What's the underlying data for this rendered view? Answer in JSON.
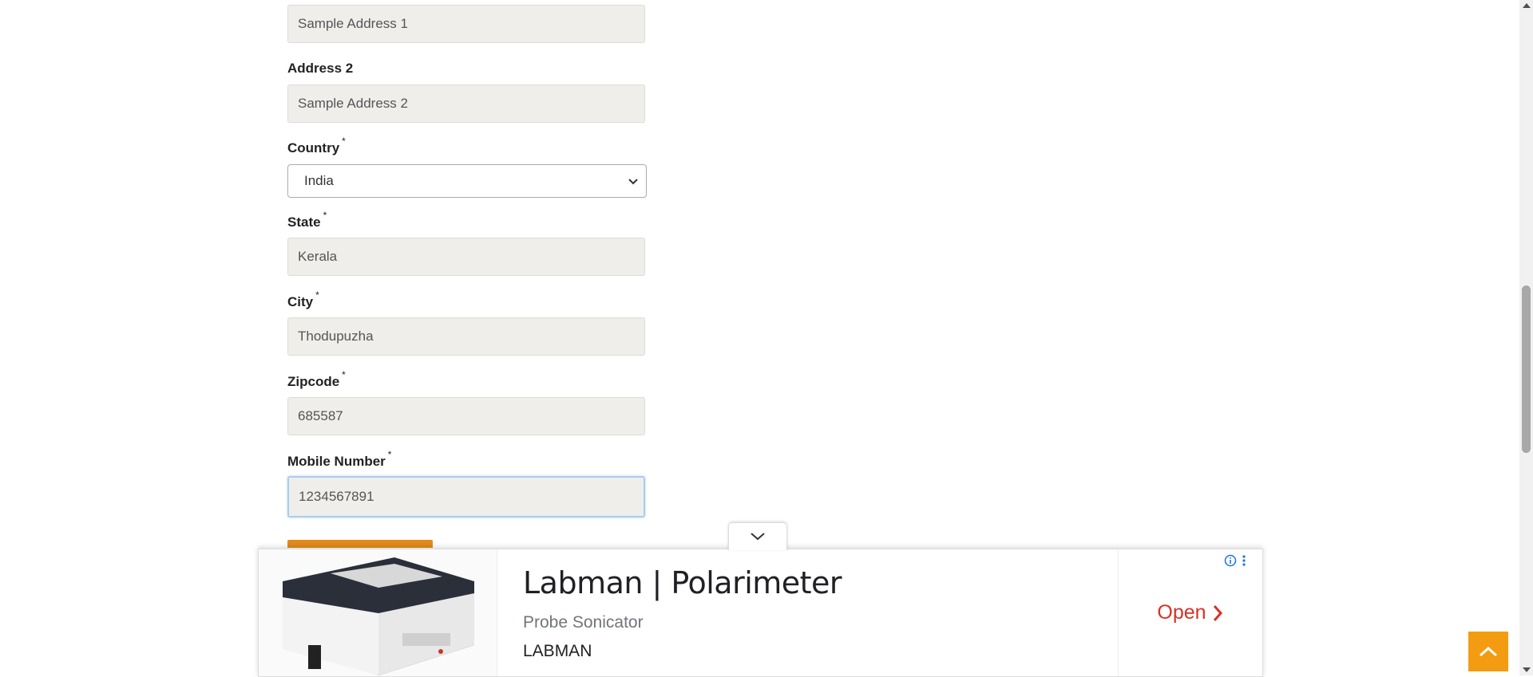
{
  "form": {
    "address1": {
      "value": "Sample Address 1"
    },
    "address2": {
      "label": "Address 2",
      "value": "Sample Address 2"
    },
    "country": {
      "label": "Country",
      "required": "*",
      "selected": "India"
    },
    "state": {
      "label": "State",
      "required": "*",
      "value": "Kerala"
    },
    "city": {
      "label": "City",
      "required": "*",
      "value": "Thodupuzha"
    },
    "zipcode": {
      "label": "Zipcode",
      "required": "*",
      "value": "685587"
    },
    "mobile": {
      "label": "Mobile Number",
      "required": "*",
      "value": "1234567891"
    }
  },
  "ad": {
    "title": "Labman | Polarimeter",
    "subtitle": "Probe Sonicator",
    "brand": "LABMAN",
    "cta": "Open",
    "accent": "#d93025"
  },
  "colors": {
    "input_bg": "#efeeea",
    "submit": "#e08a1a",
    "scrollup": "#f39c12"
  }
}
